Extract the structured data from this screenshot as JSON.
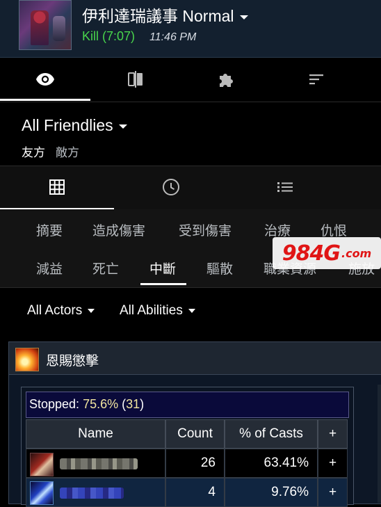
{
  "header": {
    "encounter_title": "伊利達瑞議事 Normal",
    "kill_text": "Kill (7:07)",
    "time": "11:46 PM",
    "thumbnail": "encounter-boss-thumbnail"
  },
  "top_nav": {
    "tabs": [
      {
        "icon": "eye-icon",
        "active": true
      },
      {
        "icon": "compare-icon",
        "active": false
      },
      {
        "icon": "puzzle-icon",
        "active": false
      },
      {
        "icon": "sort-icon",
        "active": false
      }
    ]
  },
  "filter_group": {
    "selected": "All Friendlies",
    "options": [
      "友方",
      "敵方"
    ]
  },
  "view_tabs": [
    {
      "icon": "grid-icon",
      "active": true
    },
    {
      "icon": "clock-icon",
      "active": false
    },
    {
      "icon": "list-icon",
      "active": false
    }
  ],
  "categories": {
    "row1": [
      "摘要",
      "造成傷害",
      "受到傷害",
      "治療",
      "仇恨"
    ],
    "row2": [
      "減益",
      "死亡",
      "中斷",
      "驅散",
      "職業資源",
      "施放"
    ],
    "active": "中斷"
  },
  "watermark": {
    "main": "984G",
    "suffix": ".com"
  },
  "filters": {
    "actors": "All Actors",
    "abilities": "All Abilities"
  },
  "ability_panel": {
    "ability_name": "恩賜懲擊",
    "stopped_label": "Stopped:",
    "stopped_pct": "75.6%",
    "stopped_count": "31",
    "columns": [
      "Name",
      "Count",
      "% of Casts",
      "+"
    ],
    "rows": [
      {
        "count": "26",
        "pct": "63.41%",
        "expand": "+"
      },
      {
        "count": "4",
        "pct": "9.76%",
        "expand": "+"
      }
    ]
  },
  "colors": {
    "header_bg": "#13202f",
    "kill_green": "#49d54c",
    "stopped_bg": "#0a0a3a",
    "highlight": "#f2e6a0",
    "row_alt_bg": "#102540"
  }
}
